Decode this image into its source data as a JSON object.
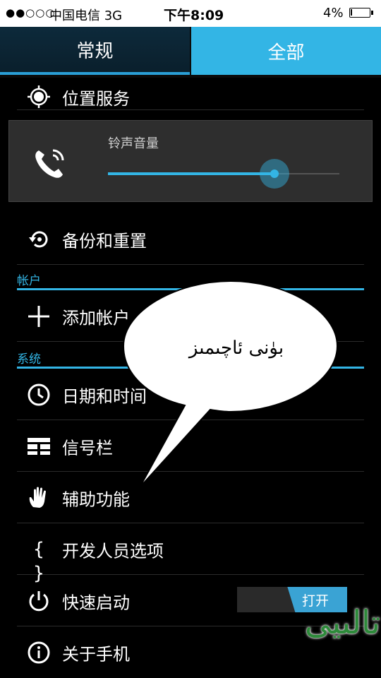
{
  "status": {
    "signal": "●●○○○",
    "carrier": "中国电信  3G",
    "time": "下午8:09",
    "battery": "4%"
  },
  "tabs": [
    {
      "label": "常规",
      "selected": false
    },
    {
      "label": "全部",
      "selected": true
    }
  ],
  "settings": {
    "location": "位置服务",
    "volume": {
      "label": "铃声音量",
      "level": 0.72
    },
    "backup": "备份和重置",
    "section_accounts": "帐户",
    "add_account": "添加帐户",
    "section_system": "系统",
    "datetime": "日期和时间",
    "statusbar": "信号栏",
    "accessibility": "辅助功能",
    "developer": "开发人员选项",
    "quick_boot": "快速启动",
    "quick_boot_toggle": "打开",
    "about": "关于手机"
  },
  "bubble": {
    "text": "بۈنى ئاچىمىز"
  },
  "watermark": {
    "text": "تالىيى"
  },
  "colors": {
    "accent": "#33b5e5",
    "background": "#000000",
    "panel": "#2e2e2e"
  }
}
